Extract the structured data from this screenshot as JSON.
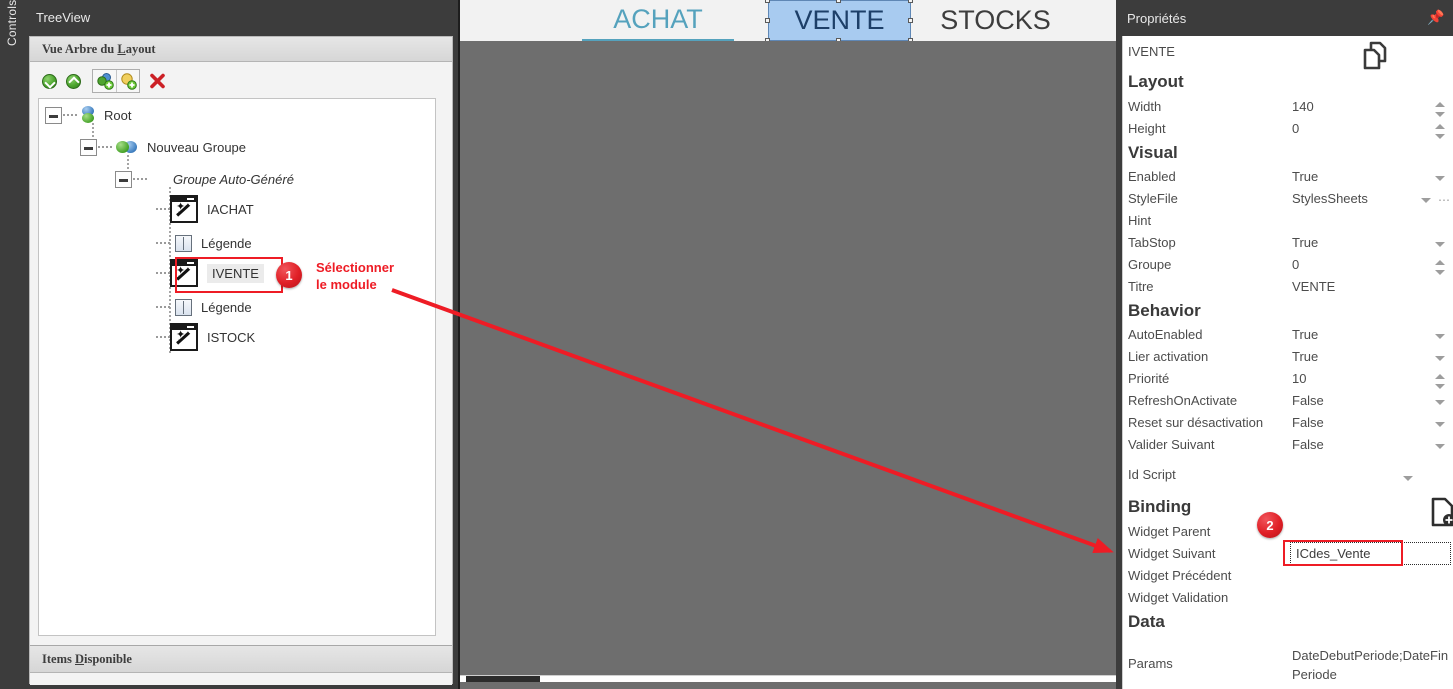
{
  "left_rail": {
    "label": "Controls"
  },
  "treeview_dock": {
    "title": "TreeView",
    "layout_section_header_pre": "Vue Arbre du ",
    "layout_section_header_key": "L",
    "layout_section_header_post": "ayout",
    "toolbar": [
      {
        "name": "expand-all",
        "glyph": "v"
      },
      {
        "name": "collapse-all",
        "glyph": "^"
      },
      {
        "name": "add-group",
        "glyph": "+"
      },
      {
        "name": "add-item",
        "glyph": "+"
      },
      {
        "name": "delete",
        "glyph": "✖"
      }
    ],
    "tree": [
      {
        "label": "Root",
        "icon": "root-spheres-icon",
        "depth": 0
      },
      {
        "label": "Nouveau Groupe",
        "icon": "group-spheres-icon",
        "depth": 1
      },
      {
        "label": "Groupe Auto-Généré",
        "icon": "none",
        "depth": 2,
        "italic": true
      },
      {
        "label": "IACHAT",
        "icon": "module-wand-icon",
        "depth": 3
      },
      {
        "label": "Légende",
        "icon": "legend-icon",
        "depth": 3
      },
      {
        "label": "IVENTE",
        "icon": "module-wand-icon",
        "depth": 3,
        "selected": true
      },
      {
        "label": "Légende",
        "icon": "legend-icon",
        "depth": 3
      },
      {
        "label": "ISTOCK",
        "icon": "module-wand-icon",
        "depth": 3
      }
    ],
    "items_section_header_pre": "Items ",
    "items_section_header_key": "D",
    "items_section_header_post": "isponible"
  },
  "center": {
    "tabs": [
      {
        "label": "ACHAT",
        "state": "active-underline"
      },
      {
        "label": "VENTE",
        "state": "selected-design"
      },
      {
        "label": "STOCKS",
        "state": "normal"
      }
    ]
  },
  "properties": {
    "title": "Propriétés",
    "pin_icon": "pin-icon",
    "object_name": "IVENTE",
    "copy_icon": "copy-pages-icon",
    "groups": [
      {
        "name": "Layout"
      },
      {
        "name": "Visual"
      },
      {
        "name": "Behavior"
      },
      {
        "name": "Binding"
      },
      {
        "name": "Data"
      }
    ],
    "rows": [
      {
        "name": "Width",
        "value": "140",
        "control": "spinner"
      },
      {
        "name": "Height",
        "value": "0",
        "control": "spinner"
      },
      {
        "name": "Enabled",
        "value": "True",
        "control": "dropdown"
      },
      {
        "name": "StyleFile",
        "value": "StylesSheets",
        "control": "dropdown-ellipsis"
      },
      {
        "name": "Hint",
        "value": "",
        "control": "none"
      },
      {
        "name": "TabStop",
        "value": "True",
        "control": "dropdown"
      },
      {
        "name": "Groupe",
        "value": "0",
        "control": "spinner"
      },
      {
        "name": "Titre",
        "value": "VENTE",
        "control": "none"
      },
      {
        "name": "AutoEnabled",
        "value": "True",
        "control": "dropdown"
      },
      {
        "name": "Lier activation",
        "value": "True",
        "control": "dropdown"
      },
      {
        "name": "Priorité",
        "value": "10",
        "control": "spinner"
      },
      {
        "name": "RefreshOnActivate",
        "value": "False",
        "control": "dropdown"
      },
      {
        "name": "Reset sur désactivation",
        "value": "False",
        "control": "dropdown"
      },
      {
        "name": "Valider Suivant",
        "value": "False",
        "control": "dropdown"
      },
      {
        "name": "Id Script",
        "value": "",
        "control": "dropdown-doc"
      },
      {
        "name": "Widget Parent",
        "value": "",
        "control": "none"
      },
      {
        "name": "Widget Suivant",
        "value": "ICdes_Vente",
        "control": "textbox-highlighted"
      },
      {
        "name": "Widget Précédent",
        "value": "",
        "control": "none"
      },
      {
        "name": "Widget Validation",
        "value": "",
        "control": "none"
      },
      {
        "name": "Params",
        "value": "DateDebutPeriode;DateFinPeriode",
        "control": "none"
      }
    ],
    "widget_suivant_value": "ICdes_Vente",
    "params_line1": "DateDebutPeriode;DateFin",
    "params_line2": "Periode"
  },
  "annotations": {
    "step1_badge": "1",
    "step1_text_line1": "Sélectionner",
    "step1_text_line2": "le module",
    "step2_badge": "2",
    "accent_color": "#ee1c25"
  }
}
